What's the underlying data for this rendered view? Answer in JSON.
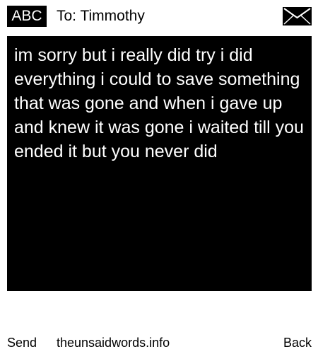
{
  "header": {
    "mode": "ABC",
    "recipient": "To: Timmothy"
  },
  "icons": {
    "envelope": "envelope-icon"
  },
  "message": {
    "body": "im sorry but i really did try i did everything i could to save something that was gone and when i gave up and knew it was gone i waited till you ended it but you never did"
  },
  "footer": {
    "send_label": "Send",
    "site": "theunsaidwords.info",
    "back_label": "Back"
  }
}
